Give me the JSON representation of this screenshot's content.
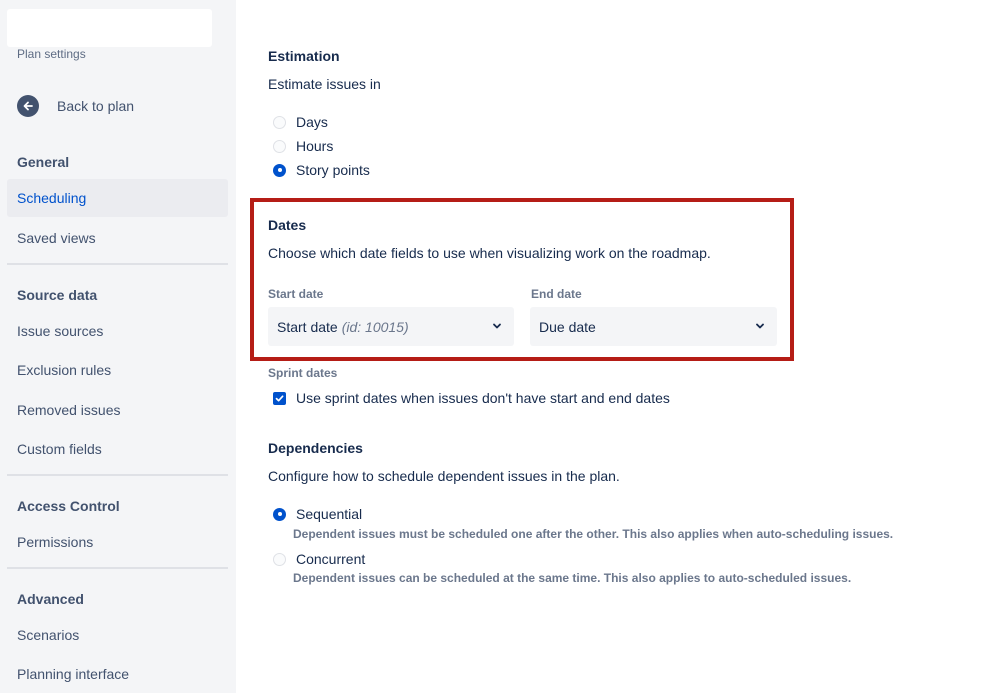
{
  "sidebar": {
    "header": "Plan settings",
    "back_label": "Back to plan",
    "sections": [
      {
        "title": "General",
        "items": [
          "Scheduling",
          "Saved views"
        ]
      },
      {
        "title": "Source data",
        "items": [
          "Issue sources",
          "Exclusion rules",
          "Removed issues",
          "Custom fields"
        ]
      },
      {
        "title": "Access Control",
        "items": [
          "Permissions"
        ]
      },
      {
        "title": "Advanced",
        "items": [
          "Scenarios",
          "Planning interface"
        ]
      }
    ],
    "selected_item": "Scheduling"
  },
  "estimation": {
    "title": "Estimation",
    "subtitle": "Estimate issues in",
    "options": [
      "Days",
      "Hours",
      "Story points"
    ],
    "selected": "Story points"
  },
  "dates": {
    "title": "Dates",
    "description": "Choose which date fields to use when visualizing work on the roadmap.",
    "start_label": "Start date",
    "start_value": "Start date",
    "start_hint": "(id: 10015)",
    "end_label": "End date",
    "end_value": "Due date"
  },
  "sprint": {
    "label": "Sprint dates",
    "checkbox_label": "Use sprint dates when issues don't have start and end dates",
    "checked": true
  },
  "dependencies": {
    "title": "Dependencies",
    "description": "Configure how to schedule dependent issues in the plan.",
    "options": [
      {
        "label": "Sequential",
        "desc": "Dependent issues must be scheduled one after the other. This also applies when auto-scheduling issues."
      },
      {
        "label": "Concurrent",
        "desc": "Dependent issues can be scheduled at the same time. This also applies to auto-scheduled issues."
      }
    ],
    "selected": "Sequential"
  },
  "colors": {
    "accent": "#0052cc",
    "highlight": "#b51d16",
    "sidebar_bg": "#f4f5f7"
  }
}
